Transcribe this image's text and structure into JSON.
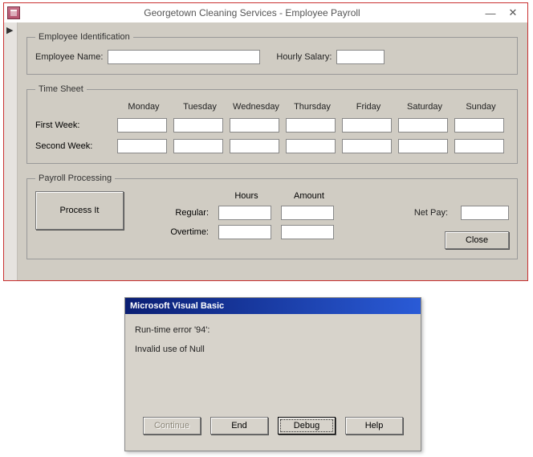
{
  "window": {
    "title": "Georgetown Cleaning Services - Employee Payroll"
  },
  "employee_ident": {
    "legend": "Employee Identification",
    "name_label": "Employee Name:",
    "name_value": "",
    "salary_label": "Hourly Salary:",
    "salary_value": ""
  },
  "time_sheet": {
    "legend": "Time Sheet",
    "headers": [
      "Monday",
      "Tuesday",
      "Wednesday",
      "Thursday",
      "Friday",
      "Saturday",
      "Sunday"
    ],
    "first_week_label": "First Week:",
    "second_week_label": "Second Week:",
    "first_week": [
      "",
      "",
      "",
      "",
      "",
      "",
      ""
    ],
    "second_week": [
      "",
      "",
      "",
      "",
      "",
      "",
      ""
    ]
  },
  "payroll": {
    "legend": "Payroll Processing",
    "process_label": "Process It",
    "hours_header": "Hours",
    "amount_header": "Amount",
    "regular_label": "Regular:",
    "overtime_label": "Overtime:",
    "regular_hours": "",
    "regular_amount": "",
    "overtime_hours": "",
    "overtime_amount": "",
    "netpay_label": "Net Pay:",
    "netpay_value": "",
    "close_label": "Close"
  },
  "vb_error": {
    "title": "Microsoft Visual Basic",
    "line1": "Run-time error '94':",
    "line2": "Invalid use of Null",
    "continue_label": "Continue",
    "end_label": "End",
    "debug_label": "Debug",
    "help_label": "Help"
  }
}
